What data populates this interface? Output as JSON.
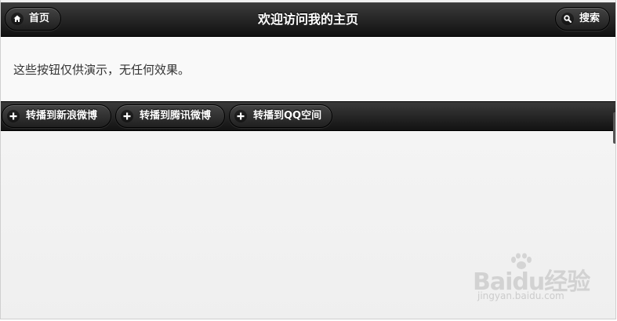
{
  "header": {
    "title": "欢迎访问我的主页",
    "left_button": {
      "label": "首页",
      "icon": "home-icon"
    },
    "right_button": {
      "label": "搜索",
      "icon": "search-icon"
    }
  },
  "content": {
    "text": "这些按钮仅供演示，无任何效果。"
  },
  "toolbar": {
    "buttons": [
      {
        "label": "转播到新浪微博",
        "icon": "plus-icon"
      },
      {
        "label": "转播到腾讯微博",
        "icon": "plus-icon"
      },
      {
        "label": "转播到QQ空间",
        "icon": "plus-icon"
      }
    ]
  },
  "watermark": {
    "brand": "Baidu经验",
    "url": "jingyan.baidu.com"
  },
  "colors": {
    "bar_dark": "#1a1a1a",
    "content_bg": "#f9f9f9",
    "text": "#333333"
  }
}
